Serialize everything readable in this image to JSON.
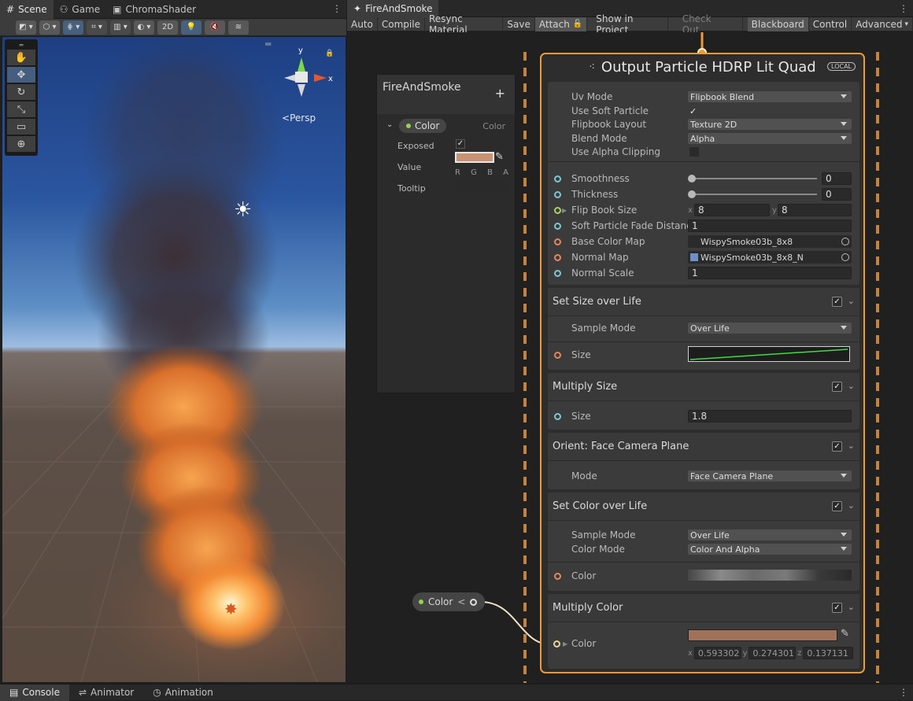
{
  "scene_tabs": [
    {
      "label": "Scene",
      "icon": "grid-icon"
    },
    {
      "label": "Game",
      "icon": "gamepad-icon"
    },
    {
      "label": "ChromaShader",
      "icon": "window-icon"
    }
  ],
  "scene_toolbar": {
    "mode_2d": "2D"
  },
  "viewport": {
    "persp_label": "Persp",
    "gizmo_y": "y",
    "gizmo_x": "x"
  },
  "vfx_tab": {
    "label": "FireAndSmoke"
  },
  "vfx_toolbar": [
    "Auto",
    "Compile",
    "Resync Material",
    "Save",
    "Attach",
    "Show in Project",
    "Check Out",
    "Blackboard",
    "Control",
    "Advanced"
  ],
  "blackboard": {
    "title": "FireAndSmoke",
    "add_label": "+",
    "property": {
      "name": "Color",
      "type": "Color"
    },
    "exposed_label": "Exposed",
    "value_label": "Value",
    "tooltip_label": "Tooltip",
    "rgba": [
      "R",
      "G",
      "B",
      "A"
    ],
    "color_hex": "#c99272"
  },
  "color_node": {
    "label": "Color",
    "arrow": "<"
  },
  "output_node": {
    "title": "Output Particle HDRP Lit Quad",
    "space_badge": "LOCAL",
    "settings": [
      {
        "label": "Uv Mode",
        "value": "Flipbook Blend"
      },
      {
        "label": "Use Soft Particle",
        "value": "✓"
      },
      {
        "label": "Flipbook Layout",
        "value": "Texture 2D"
      },
      {
        "label": "Blend Mode",
        "value": "Alpha"
      },
      {
        "label": "Use Alpha Clipping",
        "value": ""
      }
    ],
    "inputs": {
      "smoothness": {
        "label": "Smoothness",
        "value": "0"
      },
      "thickness": {
        "label": "Thickness",
        "value": "0"
      },
      "flipbook": {
        "label": "Flip Book Size",
        "x_label": "x",
        "x": "8",
        "y_label": "y",
        "y": "8"
      },
      "soft_fade": {
        "label": "Soft Particle Fade Distance",
        "value": "1"
      },
      "base_map": {
        "label": "Base Color Map",
        "value": "WispySmoke03b_8x8"
      },
      "normal_map": {
        "label": "Normal Map",
        "value": "WispySmoke03b_8x8_N"
      },
      "normal_scale": {
        "label": "Normal Scale",
        "value": "1"
      }
    },
    "blocks": {
      "size_over_life": {
        "title": "Set Size over Life",
        "sample_mode_label": "Sample Mode",
        "sample_mode": "Over Life",
        "size_label": "Size"
      },
      "multiply_size": {
        "title": "Multiply Size",
        "size_label": "Size",
        "size": "1.8"
      },
      "orient": {
        "title": "Orient: Face Camera Plane",
        "mode_label": "Mode",
        "mode": "Face Camera Plane"
      },
      "color_over_life": {
        "title": "Set Color over Life",
        "sample_mode_label": "Sample Mode",
        "sample_mode": "Over Life",
        "color_mode_label": "Color Mode",
        "color_mode": "Color And Alpha",
        "color_label": "Color"
      },
      "multiply_color": {
        "title": "Multiply Color",
        "color_label": "Color",
        "x_label": "x",
        "x": "0.593302",
        "y_label": "y",
        "y": "0.274301",
        "z_label": "z",
        "z": "0.137131"
      }
    }
  },
  "bottom_tabs": [
    {
      "label": "Console",
      "icon": "console-icon"
    },
    {
      "label": "Animator",
      "icon": "animator-icon"
    },
    {
      "label": "Animation",
      "icon": "animation-icon"
    }
  ],
  "colors": {
    "accent_orange": "#ef9a3a",
    "port_cyan": "#7ec7d1",
    "port_orange": "#e5865e",
    "multiply_color": "#a1725a"
  }
}
